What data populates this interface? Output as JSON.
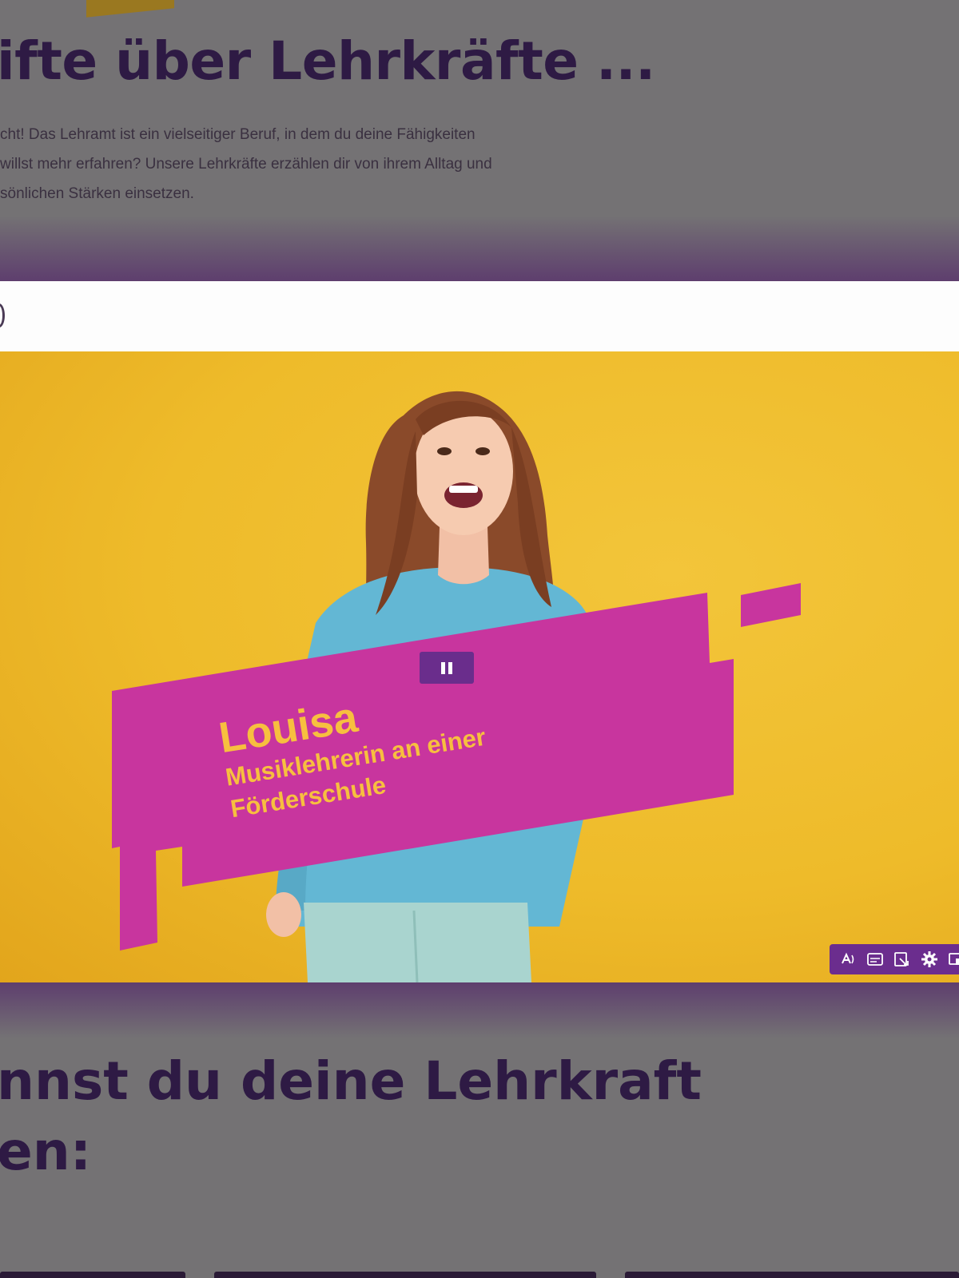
{
  "section_top": {
    "heading": "ifte über Lehrkräfte ...",
    "intro": "cht! Das Lehramt ist ein vielseitiger Beruf, in dem du deine Fähigkeiten\nwillst mehr erfahren? Unsere Lehrkräfte erzählen dir von ihrem Alltag und\nsönlichen Stärken einsetzen."
  },
  "video": {
    "name": "Louisa",
    "role": "Musiklehrerin an einer Förderschule",
    "state": "playing",
    "controls": [
      "audio-description-icon",
      "captions-icon",
      "sign-language-icon",
      "settings-icon",
      "fullscreen-icon"
    ]
  },
  "section_bottom": {
    "heading": "nnst du deine Lehrkraft\nen:"
  },
  "colors": {
    "background": "#747274",
    "heading": "#2e1a44",
    "video_background": "#eebb2a",
    "banner": "#c8359e",
    "banner_text": "#f7bf3f",
    "control_bar": "#6b2d8e"
  }
}
